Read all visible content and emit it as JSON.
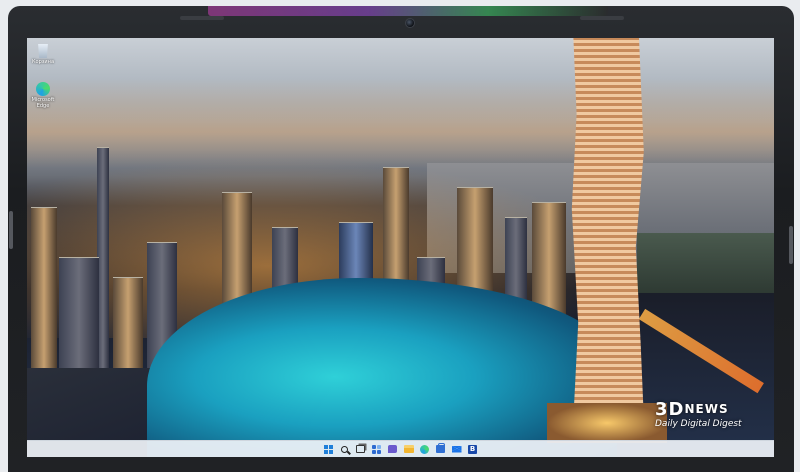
{
  "desktop": {
    "icons": [
      {
        "label": "Корзина",
        "icon": "recycle-bin-icon"
      },
      {
        "label": "Microsoft Edge",
        "icon": "edge-icon"
      }
    ]
  },
  "taskbar": {
    "items": [
      {
        "icon": "windows-start-icon"
      },
      {
        "icon": "search-icon"
      },
      {
        "icon": "task-view-icon"
      },
      {
        "icon": "widgets-icon"
      },
      {
        "icon": "chat-icon"
      },
      {
        "icon": "file-explorer-icon"
      },
      {
        "icon": "edge-icon"
      },
      {
        "icon": "store-icon"
      },
      {
        "icon": "mail-icon"
      },
      {
        "icon": "app-b-icon",
        "glyph": "B"
      }
    ]
  },
  "watermark": {
    "brand": "3D",
    "news": "NEWS",
    "tagline": "Daily Digital Digest"
  },
  "colors": {
    "bezel": "#1f2124",
    "taskbar": "#eef2f7",
    "start_accent": "#1f7fd9"
  }
}
